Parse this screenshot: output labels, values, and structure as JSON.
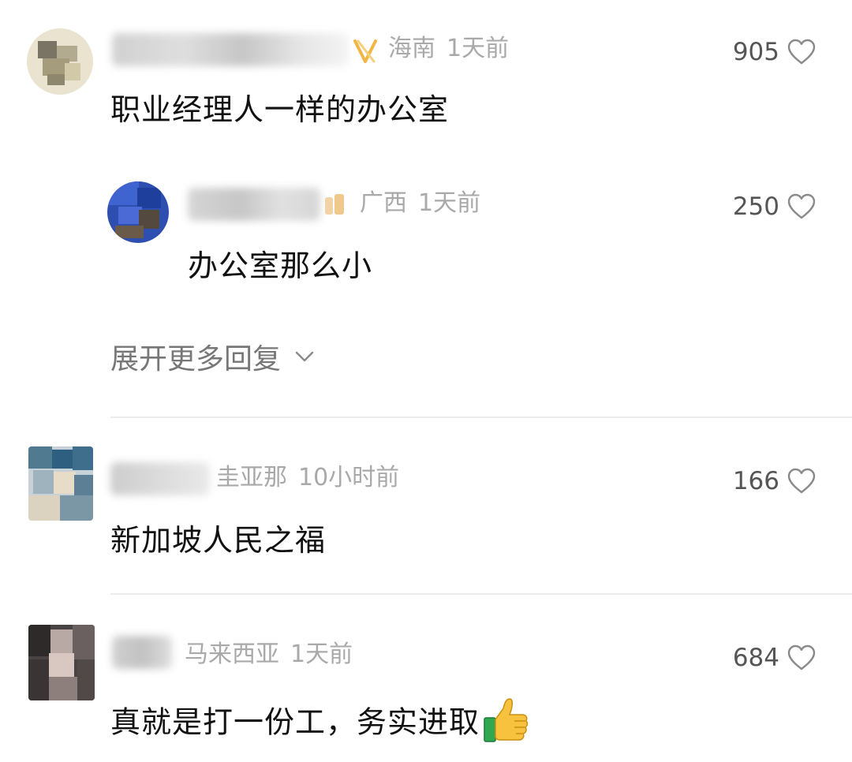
{
  "comments": [
    {
      "location": "海南",
      "time": "1天前",
      "text": "职业经理人一样的办公室",
      "likes": "905"
    },
    {
      "location": "广西",
      "time": "1天前",
      "text": "办公室那么小",
      "likes": "250"
    },
    {
      "location": "圭亚那",
      "time": "10小时前",
      "text": "新加坡人民之福",
      "likes": "166"
    },
    {
      "location": "马来西亚",
      "time": "1天前",
      "text": "真就是打一份工，务实进取",
      "likes": "684"
    }
  ],
  "expand_replies": "展开更多回复",
  "icons": {
    "like": "heart-outline-icon",
    "expand": "chevron-down-icon",
    "emoji": "thumbs-up-emoji-icon"
  },
  "colors": {
    "meta": "#a9a9a9",
    "text": "#111111",
    "divider": "#ececec"
  }
}
